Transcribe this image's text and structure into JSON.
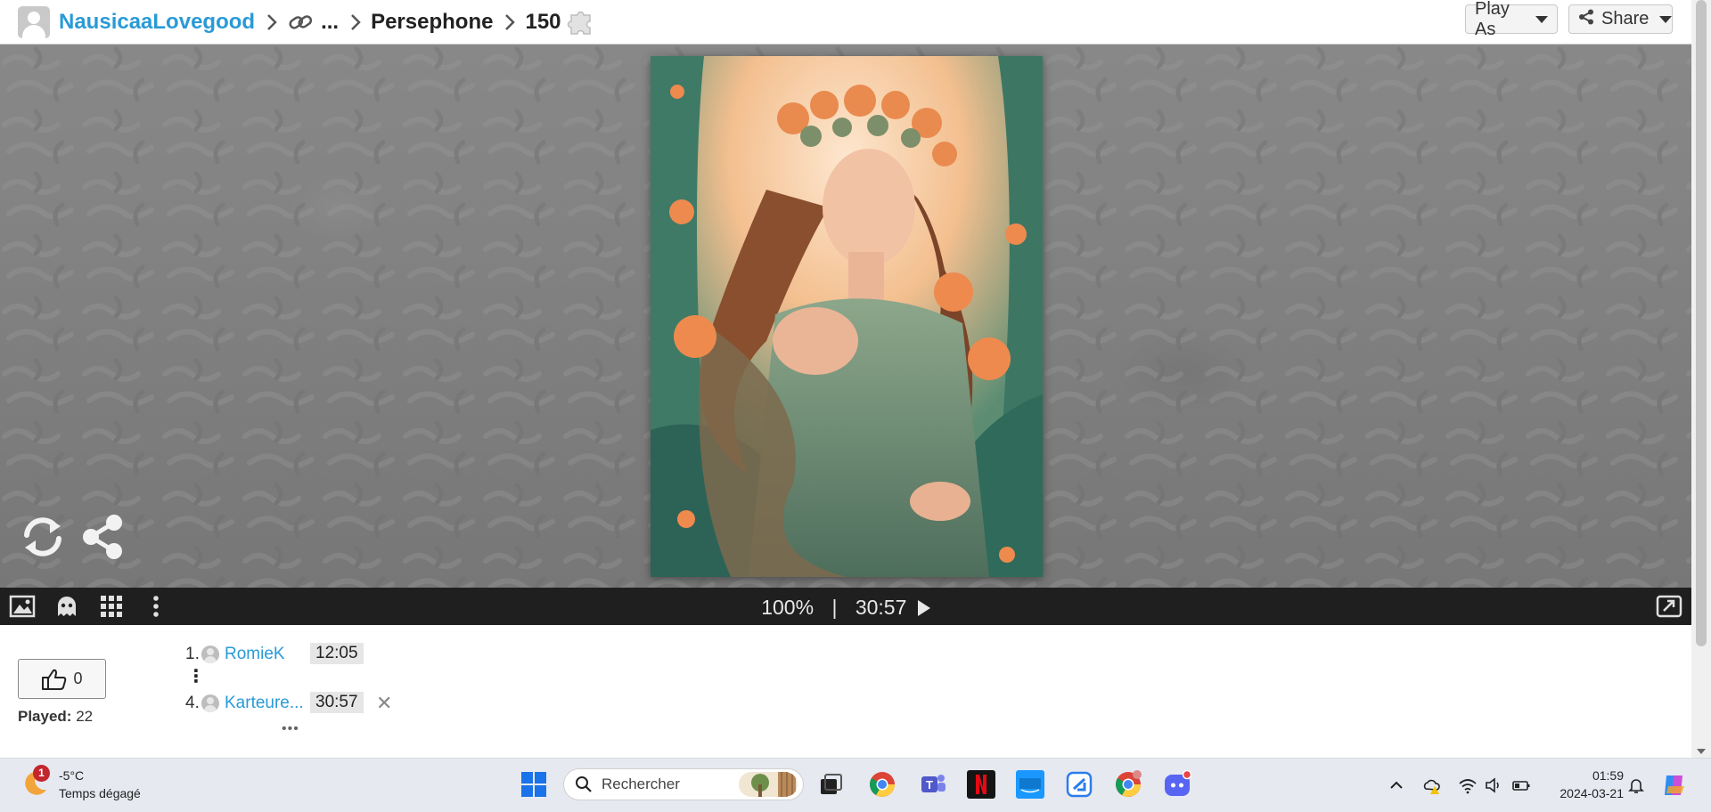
{
  "header": {
    "user": "NausicaaLovegood",
    "ellipsis": "...",
    "collection": "Persephone",
    "pieces": "150",
    "play_as_label": "Play As",
    "share_label": "Share"
  },
  "toolbar": {
    "zoom": "100%",
    "separator": "|",
    "timer": "30:57"
  },
  "like": {
    "count": "0"
  },
  "stats": {
    "played_label": "Played:",
    "played_value": "22"
  },
  "leaderboard": [
    {
      "rank": "1.",
      "name": "RomieK",
      "time": "12:05"
    },
    {
      "rank": "4.",
      "name": "Karteure...",
      "time": "30:57"
    }
  ],
  "leaderboard_more": "⋮",
  "leaderboard_expand": "•••",
  "remove_glyph": "✕",
  "taskbar": {
    "weather_badge": "1",
    "temperature": "-5°C",
    "weather_desc": "Temps dégagé",
    "search_placeholder": "Rechercher",
    "time": "01:59",
    "date": "2024-03-21",
    "apps": [
      "windows-start",
      "task-view",
      "chrome",
      "teams",
      "netflix",
      "prime-video",
      "snip",
      "chrome-profile",
      "discord"
    ]
  },
  "colors": {
    "link": "#2a9ad6",
    "toolbar_bg": "#1f1f1f",
    "stage_bg": "#808080"
  }
}
